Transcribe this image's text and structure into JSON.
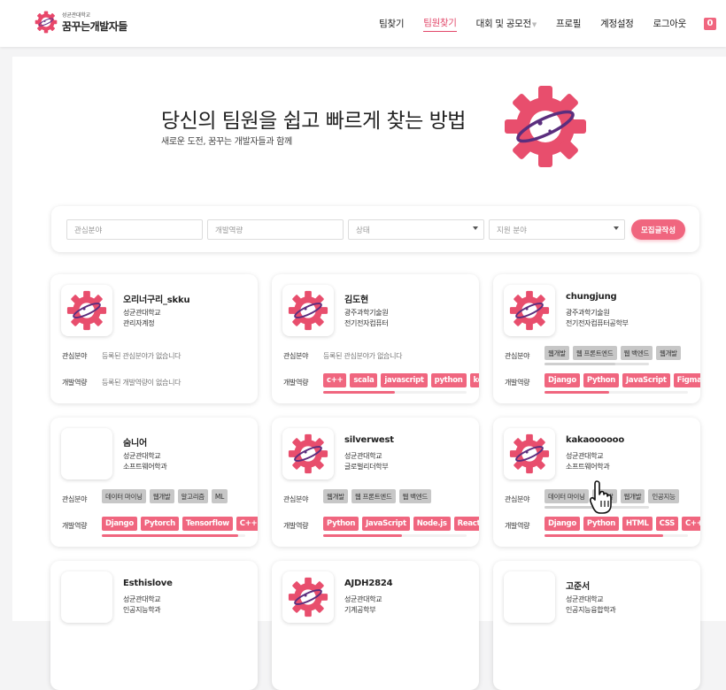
{
  "header": {
    "logo_sub": "성균관대학교",
    "logo_main": "꿈꾸는개발자들",
    "nav": [
      {
        "label": "팀찾기",
        "active": false
      },
      {
        "label": "팀원찾기",
        "active": true
      },
      {
        "label": "대회 및 공모전",
        "active": false
      },
      {
        "label": "프로필",
        "active": false
      },
      {
        "label": "계정설정",
        "active": false
      },
      {
        "label": "로그아웃",
        "active": false
      }
    ],
    "notification_count": "0"
  },
  "hero": {
    "title": "당신의 팀원을 쉽고 빠르게 찾는 방법",
    "subtitle": "새로운 도전, 꿈꾸는 개발자들과 함께"
  },
  "filters": {
    "interest_placeholder": "관심분야",
    "skill_placeholder": "개발역량",
    "status_select": "상태",
    "support_select": "지원 분야",
    "write_button": "모집글작성"
  },
  "labels": {
    "interest": "관심분야",
    "skill": "개발역량"
  },
  "cards": [
    {
      "name": "오리너구리_skku",
      "school": "성균관대학교",
      "dept": "관리자계정",
      "avatar": "gear-logo",
      "interest_empty": "등록된 관심분야가 없습니다",
      "interests": [],
      "skills_empty": "등록된 개발역량이 없습니다",
      "skills": []
    },
    {
      "name": "김도현",
      "school": "광주과학기술원",
      "dept": "전기전자컴퓨터",
      "avatar": "gear-logo",
      "interest_empty": "등록된 관심분야가 없습니다",
      "interests": [],
      "skills_empty": "",
      "skills": [
        "c++",
        "scala",
        "javascript",
        "python",
        "kotlin"
      ],
      "skills_scroll": 0.5
    },
    {
      "name": "chungjung",
      "school": "광주과학기술원",
      "dept": "전기전자컴퓨터공학부",
      "avatar": "gear-logo",
      "interest_empty": "",
      "interests": [
        "웹개발",
        "웹 프론트엔드",
        "웹 백엔드",
        "웹개발"
      ],
      "interests_scroll": 0.68,
      "skills_empty": "",
      "skills": [
        "Django",
        "Python",
        "JavaScript",
        "Figma"
      ],
      "skills_scroll": 0.45
    },
    {
      "name": "숨니어",
      "school": "성균관대학교",
      "dept": "소프트웨어학과",
      "avatar": "blank",
      "interest_empty": "",
      "interests": [
        "데이터 마이닝",
        "웹개발",
        "알고리즘",
        "ML"
      ],
      "skills_empty": "",
      "skills": [
        "Django",
        "Pytorch",
        "Tensorflow",
        "C++"
      ],
      "skills_scroll": 0.95
    },
    {
      "name": "silverwest",
      "school": "성균관대학교",
      "dept": "글로벌리더학부",
      "avatar": "gear-logo",
      "interest_empty": "",
      "interests": [
        "웹개발",
        "웹 프론트엔드",
        "웹 백엔드"
      ],
      "skills_empty": "",
      "skills": [
        "Python",
        "JavaScript",
        "Node.js",
        "React"
      ],
      "skills_scroll": 0.55
    },
    {
      "name": "kakaoooooo",
      "school": "성균관대학교",
      "dept": "소프트웨어학과",
      "avatar": "gear-logo",
      "interest_empty": "",
      "interests": [
        "데이터 마이닝",
        "웹개발",
        "웹개발",
        "인공지능"
      ],
      "interests_scroll": 0.6,
      "skills_empty": "",
      "skills": [
        "Django",
        "Python",
        "HTML",
        "CSS",
        "C++"
      ],
      "skills_scroll": 0.83
    },
    {
      "name": "Esthislove",
      "school": "성균관대학교",
      "dept": "인공지능학과",
      "avatar": "blank"
    },
    {
      "name": "AJDH2824",
      "school": "성균관대학교",
      "dept": "기계공학부",
      "avatar": "gear-logo"
    },
    {
      "name": "고준서",
      "school": "성균관대학교",
      "dept": "인공지능융합학과",
      "avatar": "blank"
    }
  ],
  "colors": {
    "accent": "#f0667f",
    "accent_dark": "#e2486a",
    "tag_gray": "#c7c7c7"
  }
}
